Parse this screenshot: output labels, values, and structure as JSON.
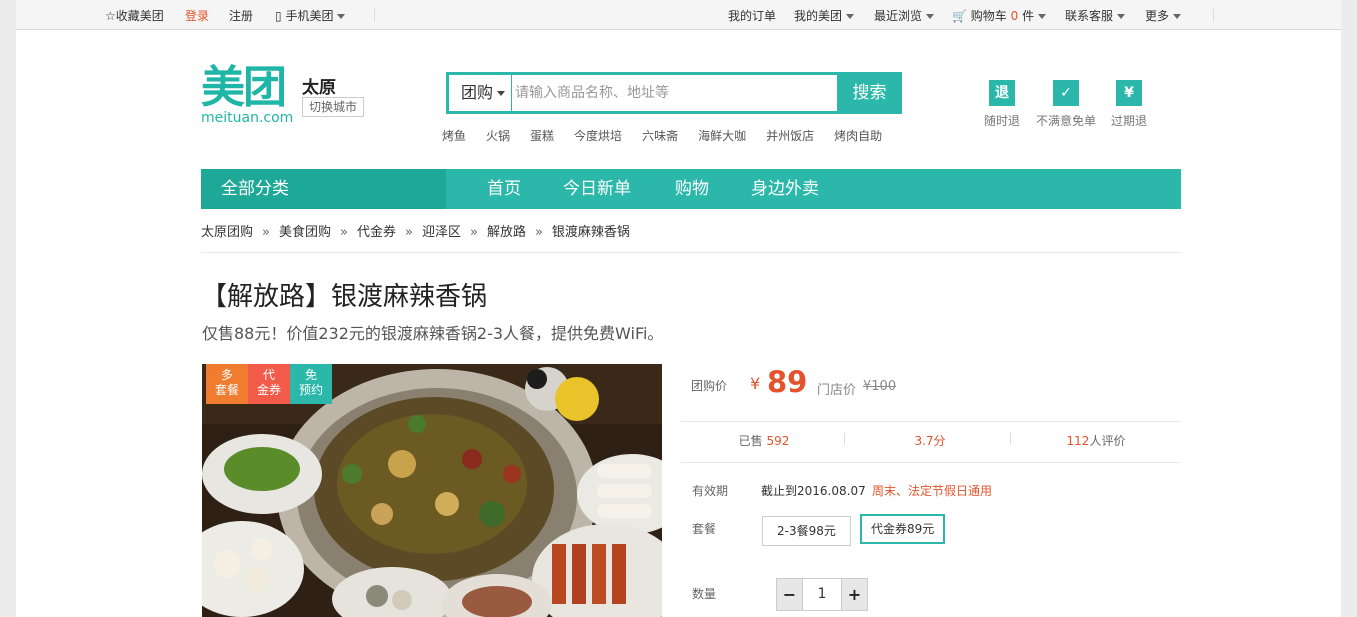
{
  "topbar": {
    "favorite": "收藏美团",
    "login": "登录",
    "register": "注册",
    "mobile": "手机美团",
    "my_orders": "我的订单",
    "my_meituan": "我的美团",
    "recent": "最近浏览",
    "cart_prefix": "购物车",
    "cart_count": "0",
    "cart_unit": "件",
    "service": "联系客服",
    "more": "更多"
  },
  "logo": {
    "cn": "美团",
    "en": "meituan.com"
  },
  "city": {
    "name": "太原",
    "switch": "切换城市"
  },
  "search": {
    "type": "团购",
    "placeholder": "请输入商品名称、地址等",
    "button": "搜索",
    "hotwords": [
      "烤鱼",
      "火锅",
      "蛋糕",
      "今度烘培",
      "六味斋",
      "海鲜大咖",
      "并州饭店",
      "烤肉自助"
    ]
  },
  "promises": [
    {
      "icon_text": "退",
      "label": "随时退"
    },
    {
      "icon_text": "✓",
      "label": "不满意免单"
    },
    {
      "icon_text": "¥",
      "label": "过期退"
    }
  ],
  "nav": {
    "all": "全部分类",
    "links": [
      "首页",
      "今日新单",
      "购物",
      "身边外卖"
    ]
  },
  "breadcrumb": [
    "太原团购",
    "美食团购",
    "代金券",
    "迎泽区",
    "解放路",
    "银渡麻辣香锅"
  ],
  "breadcrumb_sep": "»",
  "deal": {
    "title": "【解放路】银渡麻辣香锅",
    "subtitle": "仅售88元！价值232元的银渡麻辣香锅2-3人餐，提供免费WiFi。",
    "badges": [
      {
        "text": "多\n套餐",
        "color": "#f07c2f"
      },
      {
        "text": "代\n金券",
        "color": "#f25a4a"
      },
      {
        "text": "免\n预约",
        "color": "#2bb8aa"
      }
    ],
    "price_label": "团购价",
    "currency": "¥",
    "price": "89",
    "store_price_label": "门店价",
    "store_price": "¥100",
    "sold_label": "已售",
    "sold": "592",
    "rating": "3.7分",
    "reviews_count": "112",
    "reviews_label": "人评价",
    "validity_label": "有效期",
    "validity": "截止到2016.08.07",
    "validity_note": "周末、法定节假日通用",
    "package_label": "套餐",
    "packages": [
      "2-3餐98元",
      "代金券89元"
    ],
    "quantity_label": "数量",
    "quantity": "1",
    "minus": "−",
    "plus": "+"
  },
  "colors": {
    "accent": "#2bb8aa",
    "accent_dark": "#1ea898",
    "price": "#e4532b"
  }
}
